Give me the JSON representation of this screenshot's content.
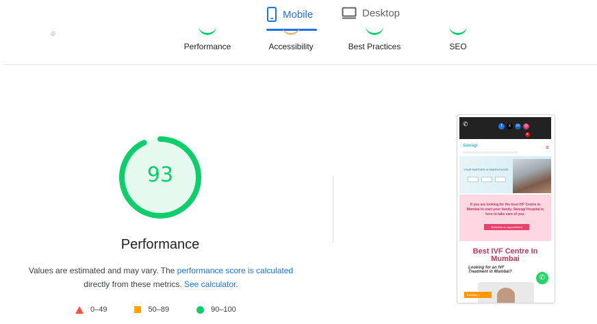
{
  "tabs": {
    "mobile": "Mobile",
    "desktop": "Desktop"
  },
  "categories": [
    "Performance",
    "Accessibility",
    "Best Practices",
    "SEO"
  ],
  "score": {
    "value": "93",
    "fraction": 0.93,
    "color": "#0cce6b",
    "title": "Performance"
  },
  "note": {
    "line1_text": "Values are estimated and may vary. The ",
    "line1_link": "performance score is calculated",
    "line2_text": "directly from these metrics. ",
    "line2_link": "See calculator",
    "line2_end": "."
  },
  "legend": [
    {
      "range": "0–49",
      "icon": "red-triangle-icon"
    },
    {
      "range": "50–89",
      "icon": "orange-square-icon"
    },
    {
      "range": "90–100",
      "icon": "green-circle-icon"
    }
  ],
  "screenshot": {
    "logo_text": "Sarvagi",
    "hero_text": "YOUR PARTNER IN PARENTHOOD",
    "pink_text": "If you are looking for the best IVF Centre in Mumbai to start your family, Sarvagi Hospital is here to take care of you.",
    "pink_button": "Schedule an appointment",
    "heading": "Best IVF Centre In Mumbai",
    "subheading": "Looking for an IVF Treatment in Mumbai?",
    "translate": "Translate »"
  },
  "colors": {
    "accent": "#1a73e8",
    "pass": "#0cce6b",
    "average": "#ffa400",
    "fail": "#ff4e42"
  }
}
